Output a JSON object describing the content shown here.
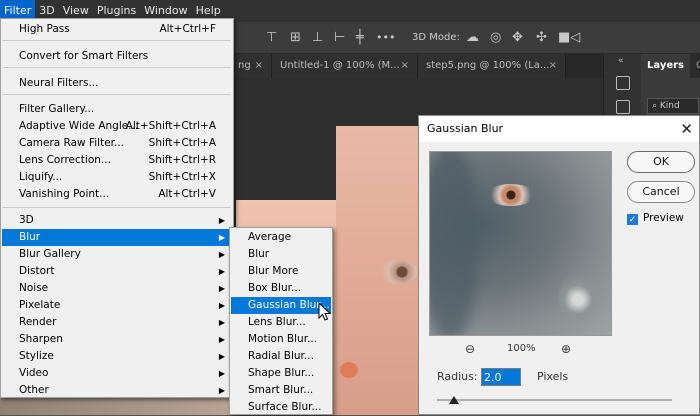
{
  "menubar": [
    "Filter",
    "3D",
    "View",
    "Plugins",
    "Window",
    "Help"
  ],
  "options_bar": {
    "mode_label": "3D Mode:"
  },
  "tabs": [
    {
      "label": "ng"
    },
    {
      "label": "Untitled-1 @ 100% (M..."
    },
    {
      "label": "step5.png @ 100% (La..."
    }
  ],
  "layers_panel": {
    "tab_layers": "Layers",
    "tab_other": "Ch",
    "kind_label": "Kind"
  },
  "filter_menu": {
    "items": [
      {
        "label": "High Pass",
        "shortcut": "Alt+Ctrl+F"
      },
      {
        "label": "Convert for Smart Filters"
      },
      {
        "label": "Neural Filters..."
      },
      {
        "label": "Filter Gallery..."
      },
      {
        "label": "Adaptive Wide Angle...",
        "shortcut": "Alt+Shift+Ctrl+A"
      },
      {
        "label": "Camera Raw Filter...",
        "shortcut": "Shift+Ctrl+A"
      },
      {
        "label": "Lens Correction...",
        "shortcut": "Shift+Ctrl+R"
      },
      {
        "label": "Liquify...",
        "shortcut": "Shift+Ctrl+X"
      },
      {
        "label": "Vanishing Point...",
        "shortcut": "Alt+Ctrl+V"
      },
      {
        "label": "3D"
      },
      {
        "label": "Blur"
      },
      {
        "label": "Blur Gallery"
      },
      {
        "label": "Distort"
      },
      {
        "label": "Noise"
      },
      {
        "label": "Pixelate"
      },
      {
        "label": "Render"
      },
      {
        "label": "Sharpen"
      },
      {
        "label": "Stylize"
      },
      {
        "label": "Video"
      },
      {
        "label": "Other"
      }
    ]
  },
  "blur_submenu": [
    "Average",
    "Blur",
    "Blur More",
    "Box Blur...",
    "Gaussian Blur...",
    "Lens Blur...",
    "Motion Blur...",
    "Radial Blur...",
    "Shape Blur...",
    "Smart Blur...",
    "Surface Blur..."
  ],
  "dialog": {
    "title": "Gaussian Blur",
    "ok": "OK",
    "cancel": "Cancel",
    "preview_label": "Preview",
    "preview_checked": true,
    "zoom": "100%",
    "radius_label": "Radius:",
    "radius_value": "2.0",
    "radius_unit": "Pixels"
  },
  "colors": {
    "highlight": "#0078d7",
    "menubar_active": "#0066cc"
  }
}
